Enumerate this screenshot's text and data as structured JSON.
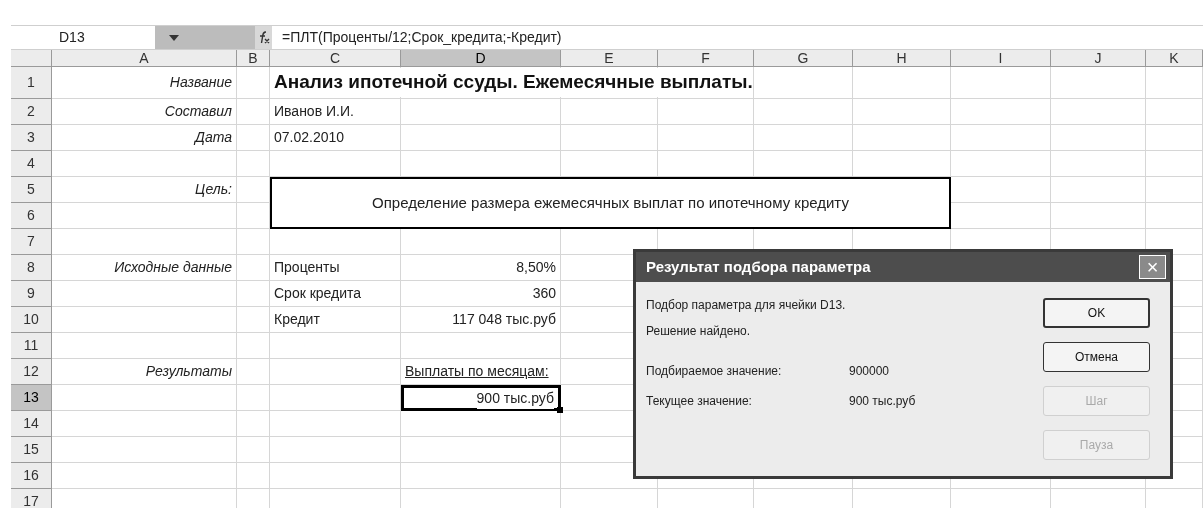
{
  "formula_bar": {
    "name_box": "D13",
    "formula": "=ПЛТ(Проценты/12;Срок_кредита;-Кредит)"
  },
  "columns": [
    {
      "label": "A",
      "selected": false
    },
    {
      "label": "B",
      "selected": false
    },
    {
      "label": "C",
      "selected": false
    },
    {
      "label": "D",
      "selected": true
    },
    {
      "label": "E",
      "selected": false
    },
    {
      "label": "F",
      "selected": false
    },
    {
      "label": "G",
      "selected": false
    },
    {
      "label": "H",
      "selected": false
    },
    {
      "label": "I",
      "selected": false
    },
    {
      "label": "J",
      "selected": false
    },
    {
      "label": "K",
      "selected": false
    }
  ],
  "rows": [
    {
      "label": "1",
      "selected": false,
      "cells": {
        "A": {
          "text": "Название",
          "kind": "caption",
          "selected": false
        },
        "C": {
          "text": "Анализ ипотечной ссуды. Ежемесячные выплаты.",
          "kind": "title",
          "selected": false
        }
      }
    },
    {
      "label": "2",
      "selected": false,
      "cells": {
        "A": {
          "text": "Составил",
          "kind": "caption",
          "selected": false
        },
        "C": {
          "text": "Иванов И.И.",
          "kind": "text",
          "selected": false
        }
      }
    },
    {
      "label": "3",
      "selected": false,
      "cells": {
        "A": {
          "text": "Дата",
          "kind": "caption",
          "selected": false
        },
        "C": {
          "text": "07.02.2010",
          "kind": "text",
          "selected": false
        }
      }
    },
    {
      "label": "4",
      "selected": false,
      "cells": {}
    },
    {
      "label": "5",
      "selected": false,
      "cells": {
        "A": {
          "text": "Цель:",
          "kind": "caption",
          "selected": false
        }
      }
    },
    {
      "label": "6",
      "selected": false,
      "cells": {}
    },
    {
      "label": "7",
      "selected": false,
      "cells": {}
    },
    {
      "label": "8",
      "selected": false,
      "cells": {
        "A": {
          "text": "Исходные данные",
          "kind": "caption",
          "selected": false
        },
        "C": {
          "text": "Проценты",
          "kind": "text",
          "selected": false
        },
        "D": {
          "text": "8,50%",
          "kind": "number",
          "selected": false
        }
      }
    },
    {
      "label": "9",
      "selected": false,
      "cells": {
        "C": {
          "text": "Срок кредита",
          "kind": "text",
          "selected": false
        },
        "D": {
          "text": "360",
          "kind": "number",
          "selected": false
        }
      }
    },
    {
      "label": "10",
      "selected": false,
      "cells": {
        "C": {
          "text": "Кредит",
          "kind": "text",
          "selected": false
        },
        "D": {
          "text": "117 048 тыс.руб",
          "kind": "number",
          "selected": false
        }
      }
    },
    {
      "label": "11",
      "selected": false,
      "cells": {}
    },
    {
      "label": "12",
      "selected": false,
      "cells": {
        "A": {
          "text": "Результаты",
          "kind": "caption",
          "selected": false
        },
        "D": {
          "text": "Выплаты по месяцам:",
          "kind": "heading",
          "selected": false
        }
      }
    },
    {
      "label": "13",
      "selected": true,
      "cells": {
        "D": {
          "text": "900 тыс.руб",
          "kind": "number",
          "selected": true
        }
      }
    },
    {
      "label": "14",
      "selected": false,
      "cells": {}
    },
    {
      "label": "15",
      "selected": false,
      "cells": {}
    },
    {
      "label": "16",
      "selected": false,
      "cells": {}
    },
    {
      "label": "17",
      "selected": false,
      "cells": {}
    }
  ],
  "goal_box": {
    "text": "Определение размера ежемесячных выплат по ипотечному кредиту"
  },
  "dialog": {
    "title": "Результат подбора параметра",
    "close": "×",
    "lines": [
      "Подбор параметра для ячейки D13.",
      "Решение найдено."
    ],
    "fields": [
      {
        "label": "Подбираемое значение:",
        "value": "900000"
      },
      {
        "label": "Текущее значение:",
        "value": "900 тыс.руб"
      }
    ],
    "buttons": [
      {
        "label": "OK",
        "disabled": false,
        "default": true
      },
      {
        "label": "Отмена",
        "disabled": false,
        "default": false
      },
      {
        "label": "Шаг",
        "disabled": true,
        "default": false
      },
      {
        "label": "Пауза",
        "disabled": true,
        "default": false
      }
    ]
  }
}
